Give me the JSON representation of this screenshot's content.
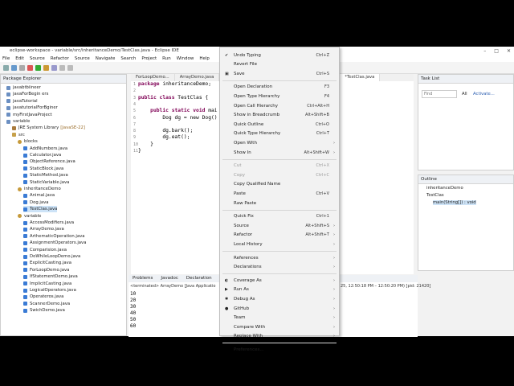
{
  "window": {
    "title": "eclipse-workspace - variable/src/inheritanceDemo/TestClas.java - Eclipse IDE"
  },
  "menubar": [
    "File",
    "Edit",
    "Source",
    "Refactor",
    "Source",
    "Navigate",
    "Search",
    "Project",
    "Run",
    "Window",
    "Help"
  ],
  "explorer": {
    "title": "Package Explorer",
    "items": [
      {
        "label": "javabtbiineer",
        "icon": "proj"
      },
      {
        "label": "javaForBegin ers",
        "icon": "proj"
      },
      {
        "label": "javaTutorial",
        "icon": "proj"
      },
      {
        "label": "javatutorialForBginer",
        "icon": "proj"
      },
      {
        "label": "myFirstJavaProject",
        "icon": "proj"
      },
      {
        "label": "variable",
        "icon": "proj"
      },
      {
        "label": "JRE System Library",
        "extra": "[JavaSE-22]",
        "icon": "jre"
      },
      {
        "label": "src",
        "icon": "src"
      },
      {
        "label": "blocks",
        "icon": "pkg"
      },
      {
        "label": "AddNumbers.java",
        "icon": "java"
      },
      {
        "label": "Calculator.java",
        "icon": "java"
      },
      {
        "label": "ObjectReference.java",
        "icon": "java"
      },
      {
        "label": "StaticBlock.java",
        "icon": "java"
      },
      {
        "label": "StaticMethod.java",
        "icon": "java"
      },
      {
        "label": "StaticVariable.java",
        "icon": "java"
      },
      {
        "label": "inheritanceDemo",
        "icon": "pkg"
      },
      {
        "label": "Animal.java",
        "icon": "java"
      },
      {
        "label": "Dog.java",
        "icon": "java"
      },
      {
        "label": "TestClas.java",
        "icon": "java",
        "selected": true
      },
      {
        "label": "variable",
        "icon": "pkg"
      },
      {
        "label": "AccessModifiers.java",
        "icon": "java"
      },
      {
        "label": "ArrayDemo.java",
        "icon": "java"
      },
      {
        "label": "ArthematicOperation.java",
        "icon": "java"
      },
      {
        "label": "AssignmentOperators.java",
        "icon": "java"
      },
      {
        "label": "Comparision.java",
        "icon": "java"
      },
      {
        "label": "DoWhileLoopDemo.java",
        "icon": "java"
      },
      {
        "label": "ExplicitCasting.java",
        "icon": "java"
      },
      {
        "label": "ForLoopDemo.java",
        "icon": "java"
      },
      {
        "label": "IfStatementDemo.java",
        "icon": "java"
      },
      {
        "label": "ImplicitCasting.java",
        "icon": "java"
      },
      {
        "label": "LogicalOperators.java",
        "icon": "java"
      },
      {
        "label": "Operateros.java",
        "icon": "java"
      },
      {
        "label": "ScannerDemo.java",
        "icon": "java"
      },
      {
        "label": "SwichDemo.java",
        "icon": "java"
      }
    ]
  },
  "editor": {
    "tabs": [
      "ForLoopDemo...",
      "ArrayDemo.java",
      "*TestClas.java"
    ],
    "line_numbers": [
      "1",
      "2",
      "3",
      "4",
      "5",
      "6",
      "7",
      "8",
      "9",
      "10",
      "11"
    ],
    "lines": [
      {
        "kw": "package",
        "rest": " inheritanceDemo;"
      },
      {
        "kw": "",
        "rest": ""
      },
      {
        "kw": "public class",
        "rest": " TestClas {"
      },
      {
        "kw": "",
        "rest": ""
      },
      {
        "kw": "    public static void",
        "rest": " mai"
      },
      {
        "kw": "",
        "rest": "        Dog dg = new Dog()"
      },
      {
        "kw": "",
        "rest": ""
      },
      {
        "kw": "",
        "rest": "        dg.bark();"
      },
      {
        "kw": "",
        "rest": "        dg.eat();"
      },
      {
        "kw": "",
        "rest": "    }"
      },
      {
        "kw": "",
        "rest": "}"
      }
    ]
  },
  "console": {
    "tabs": [
      "Problems",
      "Javadoc",
      "Declaration"
    ],
    "header": "<terminated> ArrayDemo [Java Applicatio",
    "header_right": "25, 12:50:18 PM – 12:50:20 PM) [pid: 21420]",
    "output": [
      "10",
      "20",
      "30",
      "40",
      "50",
      "60"
    ]
  },
  "context_menu": {
    "items": [
      {
        "label": "Undo Typing",
        "shortcut": "Ctrl+Z",
        "icon": "✔"
      },
      {
        "label": "Revert File",
        "shortcut": ""
      },
      {
        "label": "Save",
        "shortcut": "Ctrl+S",
        "icon": "▣"
      },
      {
        "sep": true
      },
      {
        "label": "Open Declaration",
        "shortcut": "F3"
      },
      {
        "label": "Open Type Hierarchy",
        "shortcut": "F4"
      },
      {
        "label": "Open Call Hierarchy",
        "shortcut": "Ctrl+Alt+H"
      },
      {
        "label": "Show in Breadcrumb",
        "shortcut": "Alt+Shift+B"
      },
      {
        "label": "Quick Outline",
        "shortcut": "Ctrl+O"
      },
      {
        "label": "Quick Type Hierarchy",
        "shortcut": "Ctrl+T"
      },
      {
        "label": "Open With",
        "shortcut": "",
        "submenu": true
      },
      {
        "label": "Show In",
        "shortcut": "Alt+Shift+W",
        "submenu": true
      },
      {
        "sep": true
      },
      {
        "label": "Cut",
        "shortcut": "Ctrl+X",
        "disabled": true
      },
      {
        "label": "Copy",
        "shortcut": "Ctrl+C",
        "disabled": true
      },
      {
        "label": "Copy Qualified Name",
        "shortcut": ""
      },
      {
        "label": "Paste",
        "shortcut": "Ctrl+V"
      },
      {
        "label": "Raw Paste",
        "shortcut": ""
      },
      {
        "sep": true
      },
      {
        "label": "Quick Fix",
        "shortcut": "Ctrl+1"
      },
      {
        "label": "Source",
        "shortcut": "Alt+Shift+S",
        "submenu": true
      },
      {
        "label": "Refactor",
        "shortcut": "Alt+Shift+T",
        "submenu": true
      },
      {
        "label": "Local History",
        "shortcut": "",
        "submenu": true
      },
      {
        "sep": true
      },
      {
        "label": "References",
        "shortcut": "",
        "submenu": true
      },
      {
        "label": "Declarations",
        "shortcut": "",
        "submenu": true
      },
      {
        "sep": true
      },
      {
        "label": "Coverage As",
        "shortcut": "",
        "submenu": true,
        "icon": "◐"
      },
      {
        "label": "Run As",
        "shortcut": "",
        "submenu": true,
        "icon": "▶"
      },
      {
        "label": "Debug As",
        "shortcut": "",
        "submenu": true,
        "icon": "✱"
      },
      {
        "label": "GitHub",
        "shortcut": "",
        "submenu": true,
        "icon": "●"
      },
      {
        "label": "Team",
        "shortcut": "",
        "submenu": true
      },
      {
        "label": "Compare With",
        "shortcut": "",
        "submenu": true
      },
      {
        "label": "Replace With",
        "shortcut": "",
        "submenu": true
      },
      {
        "sep": true
      },
      {
        "label": "Preferences...",
        "shortcut": ""
      }
    ]
  },
  "tasklist": {
    "title": "Task List",
    "find_placeholder": "Find",
    "all": "All",
    "activate": "Activate..."
  },
  "outline": {
    "title": "Outline",
    "items": [
      "inheritanceDemo",
      "TestClas",
      "main(String[]) : void"
    ]
  }
}
